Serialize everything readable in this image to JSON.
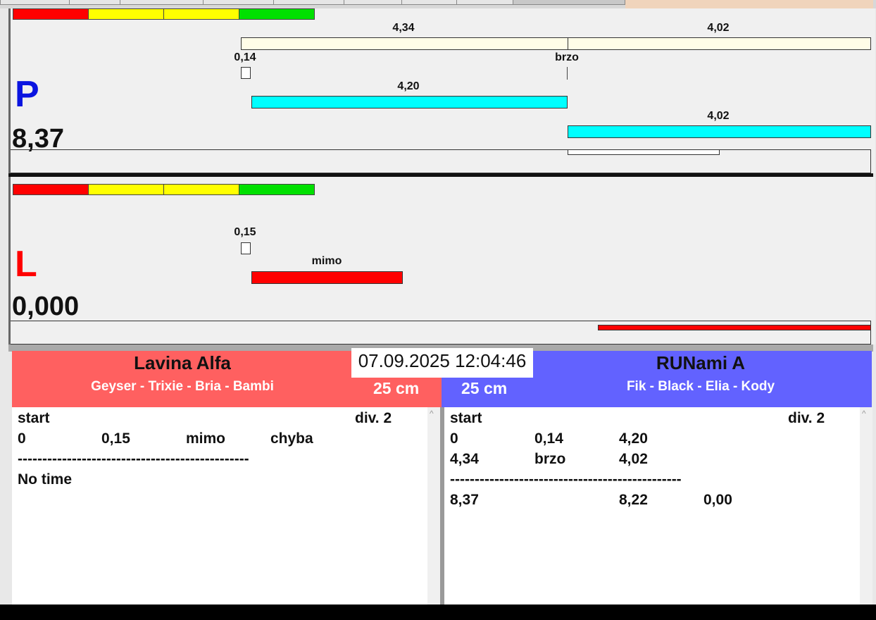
{
  "colors": {
    "seg_red": "#ff0000",
    "seg_yellow": "#ffff00",
    "seg_green": "#00e000",
    "bar_cream": "#fffde8",
    "bar_cyan": "#00ffff",
    "bar_red": "#ff0000",
    "letter_p": "#0a14e0",
    "letter_l": "#ff0000",
    "team_left_bg": "#ff6060",
    "team_right_bg": "#6262ff"
  },
  "lane_p": {
    "letter": "P",
    "time": "8,37",
    "label_top_left": "4,34",
    "label_top_right": "4,02",
    "label_start": "0,14",
    "label_fast": "brzo",
    "label_cyan_1": "4,20",
    "label_cyan_2": "4,02"
  },
  "lane_l": {
    "letter": "L",
    "time": "0,000",
    "label_start": "0,15",
    "label_miss": "mimo"
  },
  "clock": "07.09.2025 12:04:46",
  "team_left": {
    "name": "Lavina Alfa",
    "dogs": "Geyser - Trixie - Bria - Bambi",
    "height": "25 cm"
  },
  "team_right": {
    "name": "RUNami A",
    "dogs": "Fik - Black - Elia - Kody",
    "height": "25 cm"
  },
  "panel_left": {
    "start": "start",
    "division": "div.  2",
    "row1": [
      "0",
      "0,15",
      "mimo",
      "chyba"
    ],
    "separator": "-----------------------------------------------",
    "result": "No time"
  },
  "panel_right": {
    "start": "start",
    "division": "div.  2",
    "row1": [
      "0",
      "0,14",
      "4,20"
    ],
    "row2": [
      "4,34",
      "brzo",
      "4,02"
    ],
    "separator": "-----------------------------------------------",
    "totals": [
      "8,37",
      "8,22",
      "0,00"
    ]
  }
}
